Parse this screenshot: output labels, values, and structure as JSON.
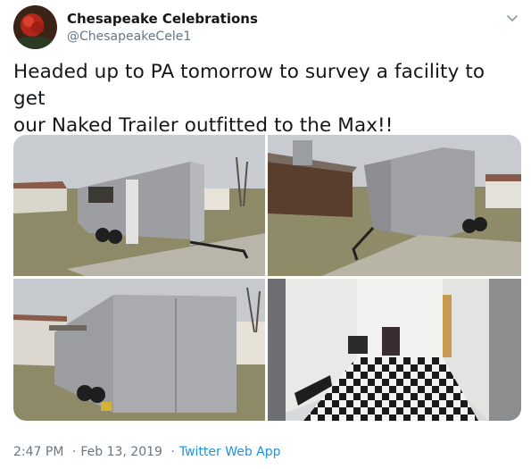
{
  "author": {
    "name": "Chesapeake Celebrations",
    "handle": "@ChesapeakeCele1"
  },
  "tweet": {
    "line1": "Headed up to PA tomorrow to survey a facility to get",
    "line2": "our Naked Trailer outfitted to the Max!!"
  },
  "meta": {
    "time": "2:47 PM",
    "separator1": "·",
    "date": "Feb 13, 2019",
    "separator2": "·",
    "source": "Twitter Web App"
  },
  "media": {
    "photos": [
      {
        "subject": "trailer-front-quarter-view"
      },
      {
        "subject": "trailer-side-view-barn"
      },
      {
        "subject": "trailer-front-close-view"
      },
      {
        "subject": "trailer-interior-checkered-floor"
      }
    ]
  },
  "icons": {
    "menu": "chevron-down-icon"
  },
  "colors": {
    "text": "#14171a",
    "secondary": "#657786",
    "link": "#1b95e0"
  }
}
